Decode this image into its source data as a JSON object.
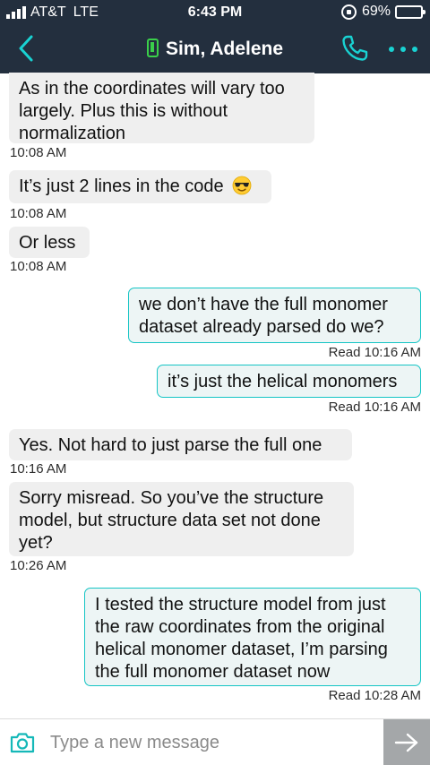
{
  "status_bar": {
    "carrier": "AT&T",
    "network": "LTE",
    "time": "6:43 PM",
    "battery_percent": "69%",
    "battery_level": 0.69,
    "battery_color": "#f5c518"
  },
  "header": {
    "contact_name": "Sim, Adelene",
    "back_icon": "chevron-left-icon",
    "call_icon": "phone-icon",
    "more_icon": "more-dots-icon",
    "background": "#232f3e",
    "accent": "#19d2d2",
    "device_icon_color": "#3ad04a"
  },
  "messages": [
    {
      "direction": "incoming",
      "lines": [
        "As in the coordinates will vary too",
        "largely. Plus this is without",
        "normalization"
      ],
      "time": "10:08 AM"
    },
    {
      "direction": "incoming",
      "text": "It’s just 2 lines in the code",
      "emoji": "smiling-face-with-sunglasses",
      "time": "10:08 AM"
    },
    {
      "direction": "incoming",
      "text": "Or less",
      "time": "10:08 AM"
    },
    {
      "direction": "outgoing",
      "lines": [
        "we don’t have the full monomer",
        "dataset already parsed do we?"
      ],
      "time": "Read 10:16 AM"
    },
    {
      "direction": "outgoing",
      "text": "it’s just the helical monomers",
      "time": "Read 10:16 AM"
    },
    {
      "direction": "incoming",
      "text": "Yes. Not hard to just parse the full one",
      "time": "10:16 AM"
    },
    {
      "direction": "incoming",
      "lines": [
        "Sorry misread. So you’ve the structure",
        "model, but structure data set not done",
        "yet?"
      ],
      "time": "10:26 AM"
    },
    {
      "direction": "outgoing",
      "lines": [
        "I tested the structure model from just",
        "the raw coordinates from the original",
        "helical monomer dataset, I’m parsing",
        "the full monomer dataset now"
      ],
      "time": "Read 10:28 AM"
    }
  ],
  "composer": {
    "placeholder": "Type a new message",
    "camera_icon": "camera-icon",
    "send_icon": "arrow-right-icon"
  },
  "colors": {
    "incoming_bubble": "#efefef",
    "outgoing_bubble": "#edf5f5",
    "outgoing_border": "#15c5c5",
    "send_button": "#a4a7a9"
  }
}
